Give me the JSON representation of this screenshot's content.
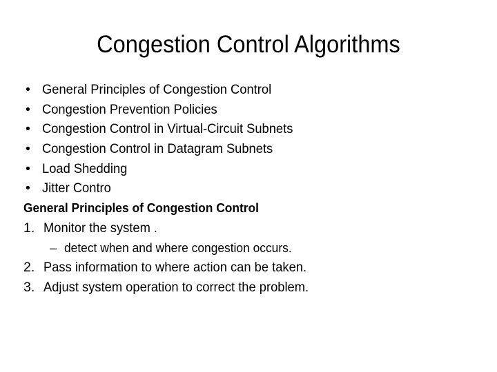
{
  "slide": {
    "title": "Congestion Control Algorithms",
    "background_color": "#ffffff",
    "text_color": "#000000",
    "bullet_glyph": "•",
    "dash_glyph": "–",
    "bullets": [
      {
        "marker": "•",
        "text": "General Principles of Congestion Control"
      },
      {
        "marker": "•",
        "text": "Congestion Prevention Policies"
      },
      {
        "marker": "•",
        "text": "Congestion Control in Virtual-Circuit Subnets"
      },
      {
        "marker": "•",
        "text": "Congestion Control in Datagram Subnets"
      },
      {
        "marker": "•",
        "text": "Load Shedding"
      },
      {
        "marker": "•",
        "text": "Jitter Contro"
      }
    ],
    "sub_heading": "General Principles of Congestion Control",
    "numbered": [
      {
        "marker": "1.",
        "text": "Monitor the system ."
      },
      {
        "marker": "–",
        "text": "detect when and where congestion occurs.",
        "level": 2
      },
      {
        "marker": "2.",
        "text": "Pass information to where action can be taken."
      },
      {
        "marker": "3.",
        "text": "Adjust system operation to correct the problem."
      }
    ]
  }
}
